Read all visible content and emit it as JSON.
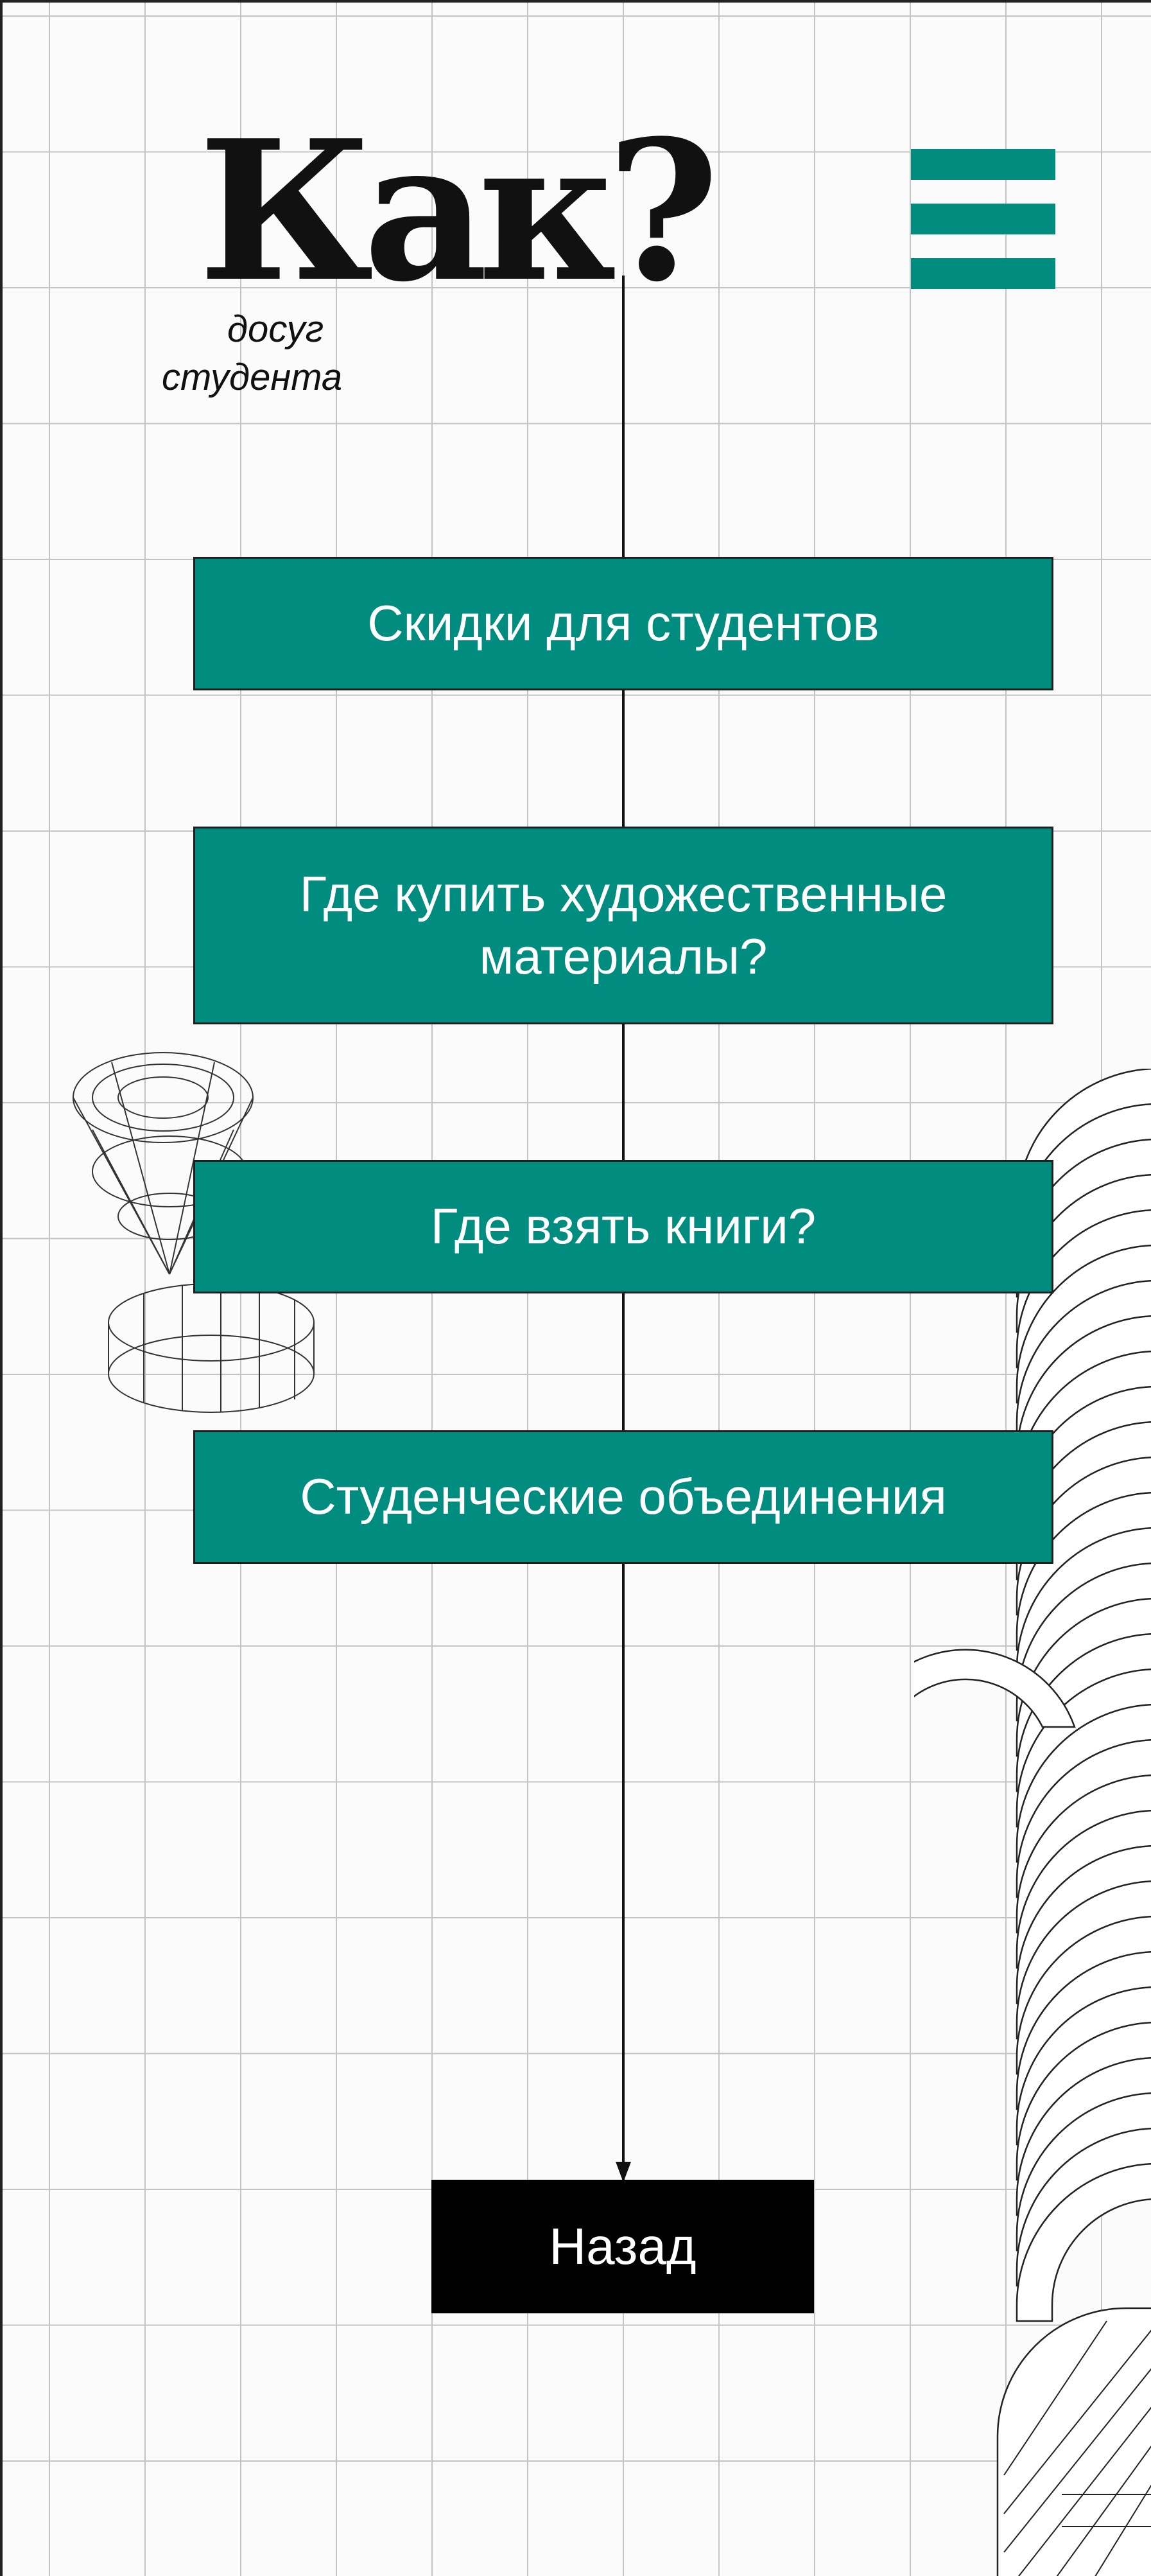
{
  "logo": {
    "title": "Как?",
    "subtitle_line1": "досуг",
    "subtitle_line2": "студента"
  },
  "menu": {
    "items": [
      {
        "label": "Скидки для студентов"
      },
      {
        "label": "Где купить художественные материалы?"
      },
      {
        "label": "Где взять книги?"
      },
      {
        "label": "Студенческие объединения"
      }
    ]
  },
  "back_button": {
    "label": "Назад"
  },
  "icons": {
    "menu": "hamburger-menu-icon"
  },
  "colors": {
    "accent": "#008c7e",
    "background": "#fbfbfb",
    "back_button": "#000000",
    "grid": "#c4c4c4"
  }
}
